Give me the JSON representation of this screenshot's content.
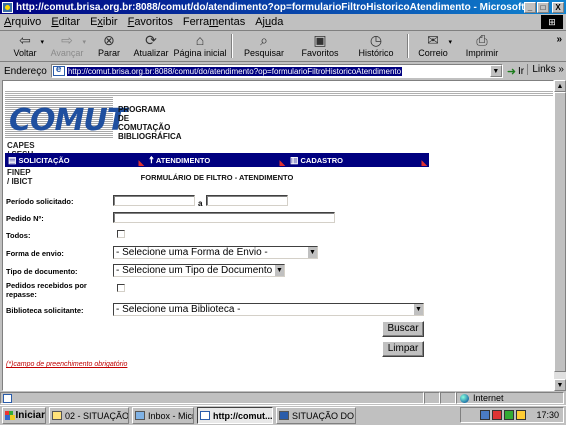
{
  "window": {
    "title": "http://comut.brisa.org.br:8088/comut/do/atendimento?op=formularioFiltroHistoricoAtendimento - Microsoft Internet Explorer",
    "min": "_",
    "max": "□",
    "close": "X"
  },
  "menu": {
    "items": [
      {
        "pre": "",
        "u": "A",
        "post": "rquivo"
      },
      {
        "pre": "",
        "u": "E",
        "post": "ditar"
      },
      {
        "pre": "E",
        "u": "x",
        "post": "ibir"
      },
      {
        "pre": "",
        "u": "F",
        "post": "avoritos"
      },
      {
        "pre": "Ferra",
        "u": "m",
        "post": "entas"
      },
      {
        "pre": "Aj",
        "u": "u",
        "post": "da"
      }
    ]
  },
  "toolbar": {
    "back": "Voltar",
    "forward": "Avançar",
    "stop": "Parar",
    "refresh": "Atualizar",
    "home": "Página inicial",
    "search": "Pesquisar",
    "favorites": "Favoritos",
    "history": "Histórico",
    "mail": "Correio",
    "print": "Imprimir",
    "more": "»",
    "icons": {
      "back": "arrow-left-icon",
      "forward": "arrow-right-icon",
      "stop": "stop-icon",
      "refresh": "refresh-icon",
      "home": "home-icon",
      "search": "search-icon",
      "favorites": "favorites-icon",
      "history": "history-icon",
      "mail": "mail-icon",
      "print": "printer-icon"
    }
  },
  "address": {
    "label": "Endereço",
    "url": "http://comut.brisa.org.br:8088/comut/do/atendimento?op=formularioFiltroHistoricoAtendimento",
    "go": "Ir",
    "links": "Links »"
  },
  "logo": {
    "brand": "COMUT",
    "program": [
      "PROGRAMA",
      "DE COMUTAÇÃO",
      "BIBLIOGRÁFICA"
    ],
    "sponsors": "CAPES / SESU / FINEP / IBICT",
    "brand_color": "#1f4f9f"
  },
  "nav": {
    "items": [
      {
        "label": "SOLICITAÇÃO",
        "icon": "form-icon"
      },
      {
        "label": "ATENDIMENTO",
        "icon": "person-icon"
      },
      {
        "label": "CADASTRO",
        "icon": "list-icon"
      }
    ],
    "bg_color": "#00007f"
  },
  "form": {
    "title": "FORMULÁRIO DE FILTRO - ATENDIMENTO",
    "periodo_label": "Período solicitado:",
    "periodo_sep": "a",
    "pedido_label": "Pedido Nº:",
    "todos_label": "Todos:",
    "forma_label": "Forma de envio:",
    "forma_value": "- Selecione uma Forma de Envio -",
    "tipo_label": "Tipo de documento:",
    "tipo_value": "- Selecione um Tipo de Documento -",
    "repasse_label_1": "Pedidos recebidos por",
    "repasse_label_2": "repasse:",
    "biblioteca_label": "Biblioteca solicitante:",
    "biblioteca_value": "- Selecione uma Biblioteca -",
    "buscar": "Buscar",
    "limpar": "Limpar",
    "required_note": "(*)campo de preenchimento obrigatório"
  },
  "status": {
    "zone": "Internet"
  },
  "taskbar": {
    "start": "Iniciar",
    "tasks": [
      {
        "label": "02 - SITUAÇÃO...",
        "active": false
      },
      {
        "label": "Inbox - Microsof...",
        "active": false
      },
      {
        "label": "http://comut...",
        "active": true
      },
      {
        "label": "SITUAÇÃO DO ...",
        "active": false
      }
    ],
    "clock": "17:30"
  }
}
